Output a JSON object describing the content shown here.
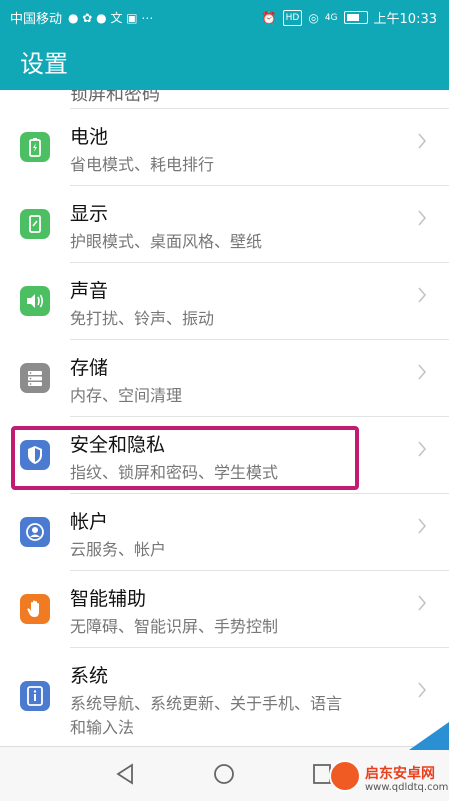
{
  "statusbar": {
    "carrier": "中国移动",
    "time": "上午10:33",
    "hd": "HD",
    "signal": "4G"
  },
  "header": {
    "title": "设置"
  },
  "partial_row": {
    "text": "锁屏和密码"
  },
  "items": [
    {
      "label": "电池",
      "sub": "省电模式、耗电排行",
      "icon": "battery-icon",
      "color": "#4cbf63"
    },
    {
      "label": "显示",
      "sub": "护眼模式、桌面风格、壁纸",
      "icon": "display-icon",
      "color": "#4cbf63"
    },
    {
      "label": "声音",
      "sub": "免打扰、铃声、振动",
      "icon": "sound-icon",
      "color": "#4cbf63"
    },
    {
      "label": "存储",
      "sub": "内存、空间清理",
      "icon": "storage-icon",
      "color": "#8c8c8c"
    },
    {
      "label": "安全和隐私",
      "sub": "指纹、锁屏和密码、学生模式",
      "icon": "shield-icon",
      "color": "#4a7bd1"
    },
    {
      "label": "帐户",
      "sub": "云服务、帐户",
      "icon": "account-icon",
      "color": "#4a7bd1"
    },
    {
      "label": "智能辅助",
      "sub": "无障碍、智能识屏、手势控制",
      "icon": "hand-icon",
      "color": "#f07b22"
    },
    {
      "label": "系统",
      "sub": "系统导航、系统更新、关于手机、语言",
      "sub2": "和输入法",
      "icon": "system-info-icon",
      "color": "#4a7bd1"
    }
  ],
  "watermark": {
    "title": "启东安卓网",
    "url": "www.qdldtq.com"
  },
  "colors": {
    "accent": "#10a7b6",
    "highlight": "#c21b73"
  }
}
